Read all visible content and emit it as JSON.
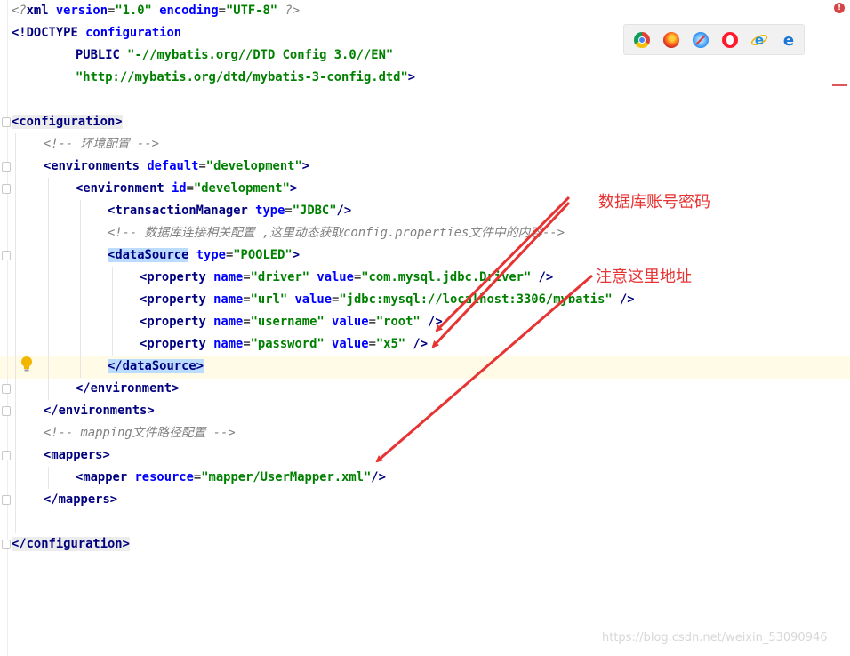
{
  "code": {
    "xml_decl": {
      "open": "<?",
      "name": "xml",
      "version_attr": "version",
      "version_val": "\"1.0\"",
      "encoding_attr": "encoding",
      "encoding_val": "\"UTF-8\"",
      "close": "?>"
    },
    "doctype": {
      "open": "<!DOCTYPE",
      "name": "configuration"
    },
    "doctype_public": {
      "keyword": "PUBLIC",
      "id": "\"-//mybatis.org//DTD Config 3.0//EN\""
    },
    "doctype_url": {
      "url": "\"http://mybatis.org/dtd/mybatis-3-config.dtd\"",
      "close": ">"
    },
    "configuration_open": "configuration",
    "comment_env": "<!-- 环境配置 -->",
    "environments": {
      "tag": "environments",
      "attr": "default",
      "val": "\"development\""
    },
    "environment": {
      "tag": "environment",
      "attr": "id",
      "val": "\"development\""
    },
    "transaction": {
      "tag": "transactionManager",
      "attr": "type",
      "val": "\"JDBC\"",
      "close": "/>"
    },
    "comment_ds": "<!-- 数据库连接相关配置 ,这里动态获取config.properties文件中的内容-->",
    "datasource": {
      "tag": "dataSource",
      "attr": "type",
      "val": "\"POOLED\""
    },
    "properties": [
      {
        "tag": "property",
        "name_attr": "name",
        "name_val": "\"driver\"",
        "value_attr": "value",
        "value_val": "\"com.mysql.jdbc.Driver\"",
        "close": "/>"
      },
      {
        "tag": "property",
        "name_attr": "name",
        "name_val": "\"url\"",
        "value_attr": "value",
        "value_val": "\"jdbc:mysql://localhost:3306/mybatis\"",
        "close": "/>"
      },
      {
        "tag": "property",
        "name_attr": "name",
        "name_val": "\"username\"",
        "value_attr": "value",
        "value_val": "\"root\"",
        "close": "/>"
      },
      {
        "tag": "property",
        "name_attr": "name",
        "name_val": "\"password\"",
        "value_attr": "value",
        "value_val": "\"x5\"",
        "close": "/>"
      }
    ],
    "datasource_close": "dataSource",
    "environment_close": "environment",
    "environments_close": "environments",
    "comment_mapping": "<!-- mapping文件路径配置 -->",
    "mappers_open": "mappers",
    "mapper": {
      "tag": "mapper",
      "attr": "resource",
      "val": "\"mapper/UserMapper.xml\"",
      "close": "/>"
    },
    "mappers_close": "mappers",
    "configuration_close": "configuration"
  },
  "browser_icons": [
    "chrome-icon",
    "firefox-icon",
    "safari-icon",
    "opera-icon",
    "internet-explorer-icon",
    "edge-icon"
  ],
  "error_marker": "!",
  "annotations": {
    "db_account": "数据库账号密码",
    "url_note": "注意这里地址"
  },
  "watermark": "https://blog.csdn.net/weixin_53090946",
  "colors": {
    "tag": "#000080",
    "attribute": "#0000ff",
    "value": "#008000",
    "comment": "#808080",
    "annotation": "#e83333",
    "highlight": "#bcdcff"
  }
}
